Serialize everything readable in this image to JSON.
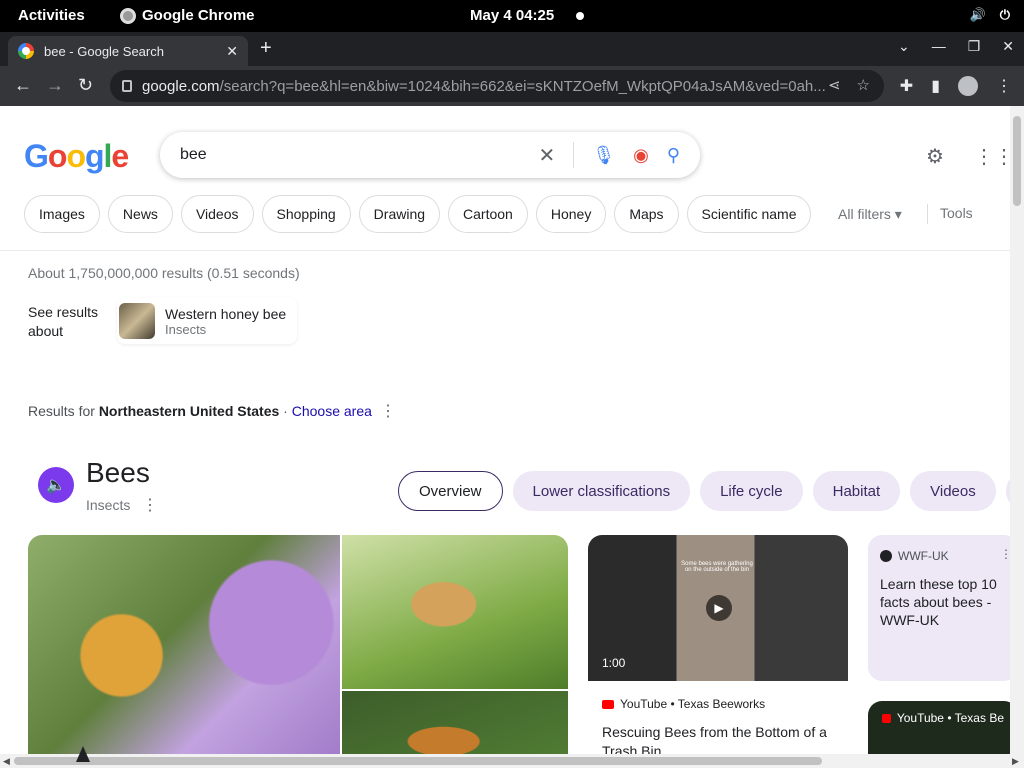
{
  "system_bar": {
    "activities": "Activities",
    "app_name": "Google Chrome",
    "clock": "May 4  04:25"
  },
  "browser": {
    "tab_title": "bee - Google Search",
    "url_host": "google.com",
    "url_path": "/search?q=bee&hl=en&biw=1024&bih=662&ei=sKNTZOefM_WkptQP04aJsAM&ved=0ah..."
  },
  "google": {
    "logo": [
      "G",
      "o",
      "o",
      "g",
      "l",
      "e"
    ],
    "query": "bee",
    "chips": [
      "Images",
      "News",
      "Videos",
      "Shopping",
      "Drawing",
      "Cartoon",
      "Honey",
      "Maps",
      "Scientific name"
    ],
    "all_filters": "All filters",
    "tools": "Tools",
    "stats": "About 1,750,000,000 results (0.51 seconds)",
    "see_results_about": "See results about",
    "entity": {
      "title": "Western honey bee",
      "subtitle": "Insects"
    },
    "region": {
      "prefix": "Results for ",
      "place": "Northeastern United States",
      "separator": " · ",
      "choose": "Choose area"
    }
  },
  "knowledge": {
    "title": "Bees",
    "subtitle": "Insects",
    "tabs": [
      "Overview",
      "Lower classifications",
      "Life cycle",
      "Habitat",
      "Videos",
      "Bi"
    ],
    "video": {
      "caption": "Some bees were gathering on the outside of the bin",
      "duration": "1:00",
      "source": "YouTube • Texas Beeworks",
      "title": "Rescuing Bees from the Bottom of a Trash Bin"
    },
    "article": {
      "source": "WWF-UK",
      "title": "Learn these top 10 facts about bees - WWF-UK"
    },
    "video2_source": "YouTube • Texas Be"
  },
  "colors": {
    "accent_purple": "#7c3aed",
    "chip_tint": "#ede7f6",
    "link": "#1a0dab",
    "brand_blue": "#4285f4"
  }
}
